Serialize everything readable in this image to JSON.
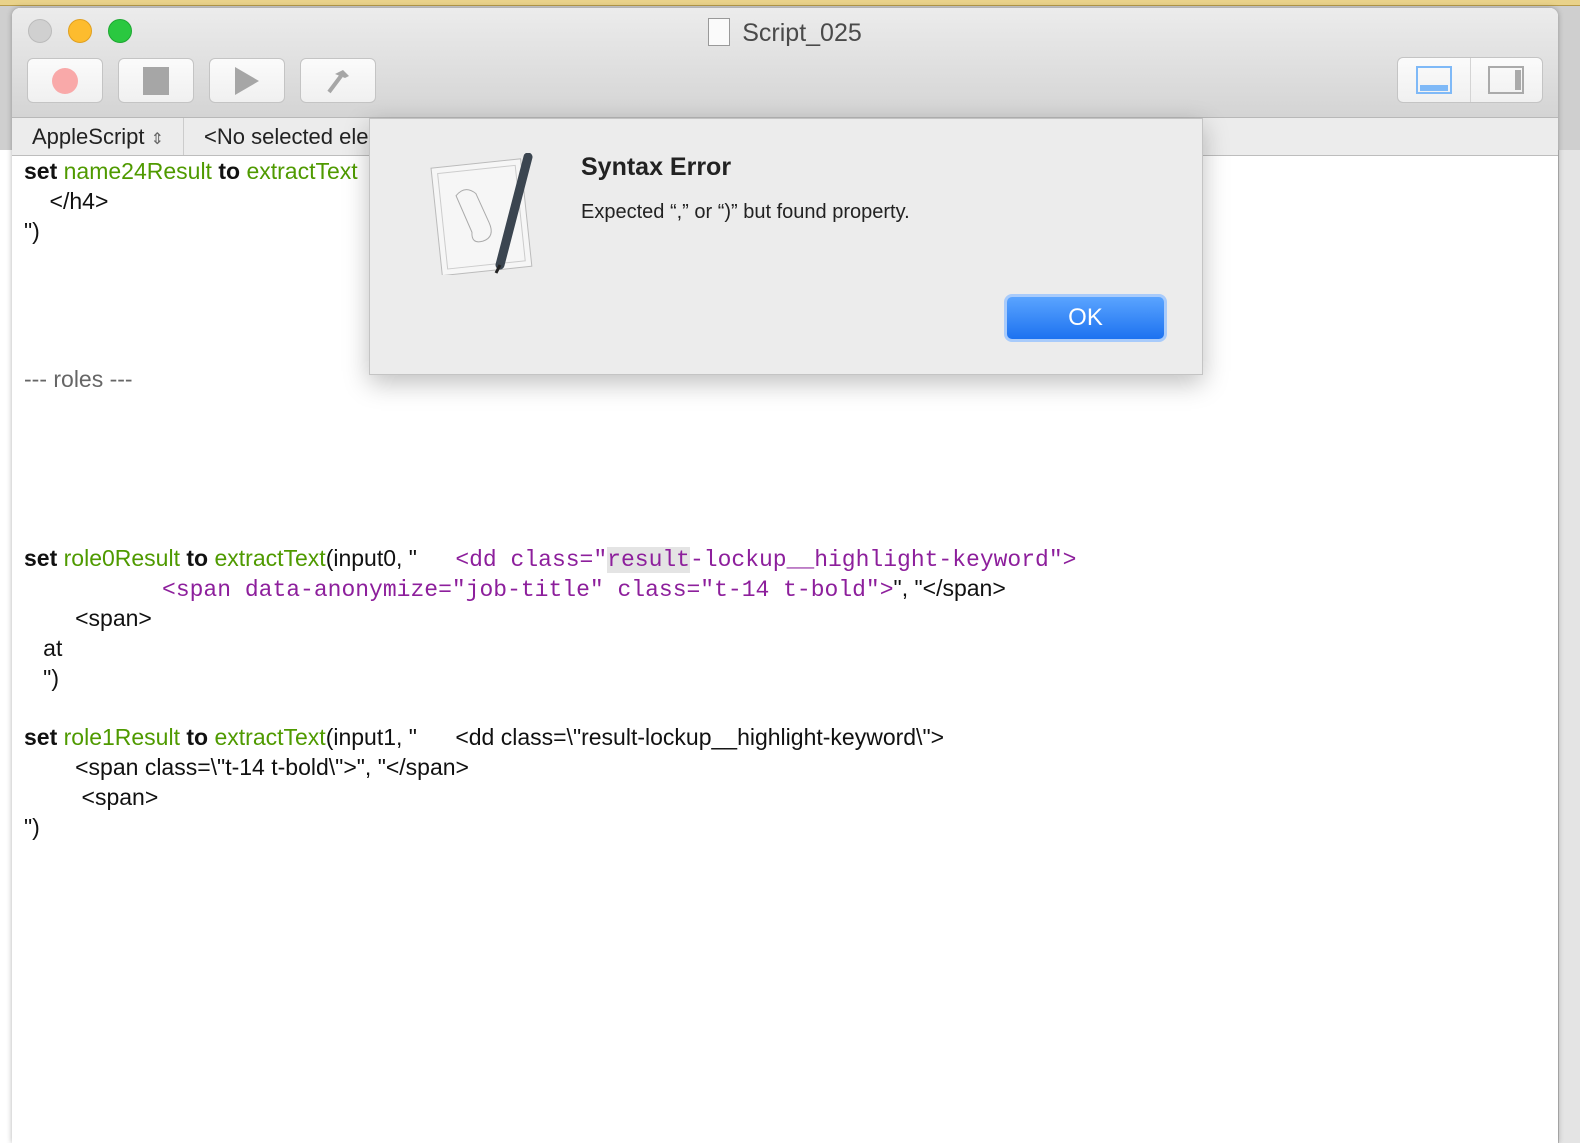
{
  "window": {
    "title": "Script_025"
  },
  "toolbar": {
    "record": "record",
    "stop": "stop",
    "run": "run",
    "compile": "compile"
  },
  "navbar": {
    "language": "AppleScript",
    "element": "<No selected element>"
  },
  "code": {
    "l1": [
      "set",
      " name24Result ",
      "to",
      " extractText"
    ],
    "l2": "    </h4>",
    "l3": "\")",
    "l4": "--- roles ---",
    "r0": [
      "set",
      " role0Result ",
      "to",
      " extractText",
      "(input0, \"      ",
      "<dd class=\"",
      "result",
      "-lockup__highlight-keyword\">"
    ],
    "r0b": [
      "          <span data-anonymize=\"job-title\" class=\"t-14 t-bold\">",
      "\", \"</span>"
    ],
    "r0c": "        <span>",
    "r0d": "   at",
    "r0e": "   \")",
    "r1": [
      "set",
      " role1Result ",
      "to",
      " extractText",
      "(input1, \"      <dd class=\\\"result-lockup__highlight-keyword\\\">"
    ],
    "r1b": "        <span class=\\\"t-14 t-bold\\\">\", \"</span>",
    "r1c": "         <span>",
    "r1d": "\")"
  },
  "dialog": {
    "title": "Syntax Error",
    "message": "Expected “,” or “)” but found property.",
    "ok": "OK"
  }
}
